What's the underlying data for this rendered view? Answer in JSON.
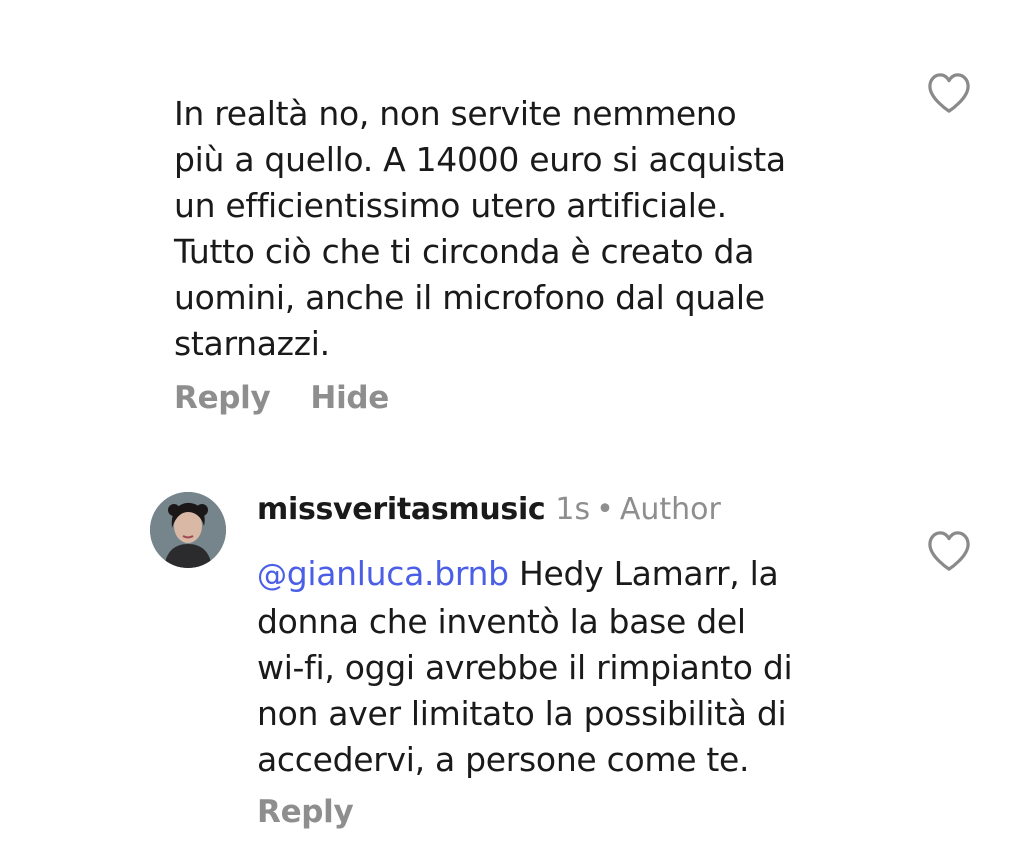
{
  "comments": [
    {
      "text": "In realtà no, non servite nemmeno\npiù a quello. A 14000 euro si acquista\nun efficientissimo utero artificiale.\nTutto ciò che ti circonda è creato da\nuomini, anche il microfono dal quale\nstarnazzi.",
      "reply_label": "Reply",
      "hide_label": "Hide",
      "like_icon": "heart-outline-icon"
    },
    {
      "username": "missveritasmusic",
      "time": "1s",
      "separator": "•",
      "author_badge": "Author",
      "mention_symbol": "@",
      "mention_user": "gianluca.brnb",
      "text": " Hedy Lamarr, la\ndonna che inventò la base del\nwi-fi, oggi avrebbe il rimpianto di\nnon aver limitato la possibilità di\naccedervi, a persone come te.",
      "reply_label": "Reply",
      "like_icon": "heart-outline-icon"
    }
  ],
  "colors": {
    "text": "#1a1a1a",
    "muted": "#8e8e8e",
    "mention": "#4a5ee6"
  }
}
